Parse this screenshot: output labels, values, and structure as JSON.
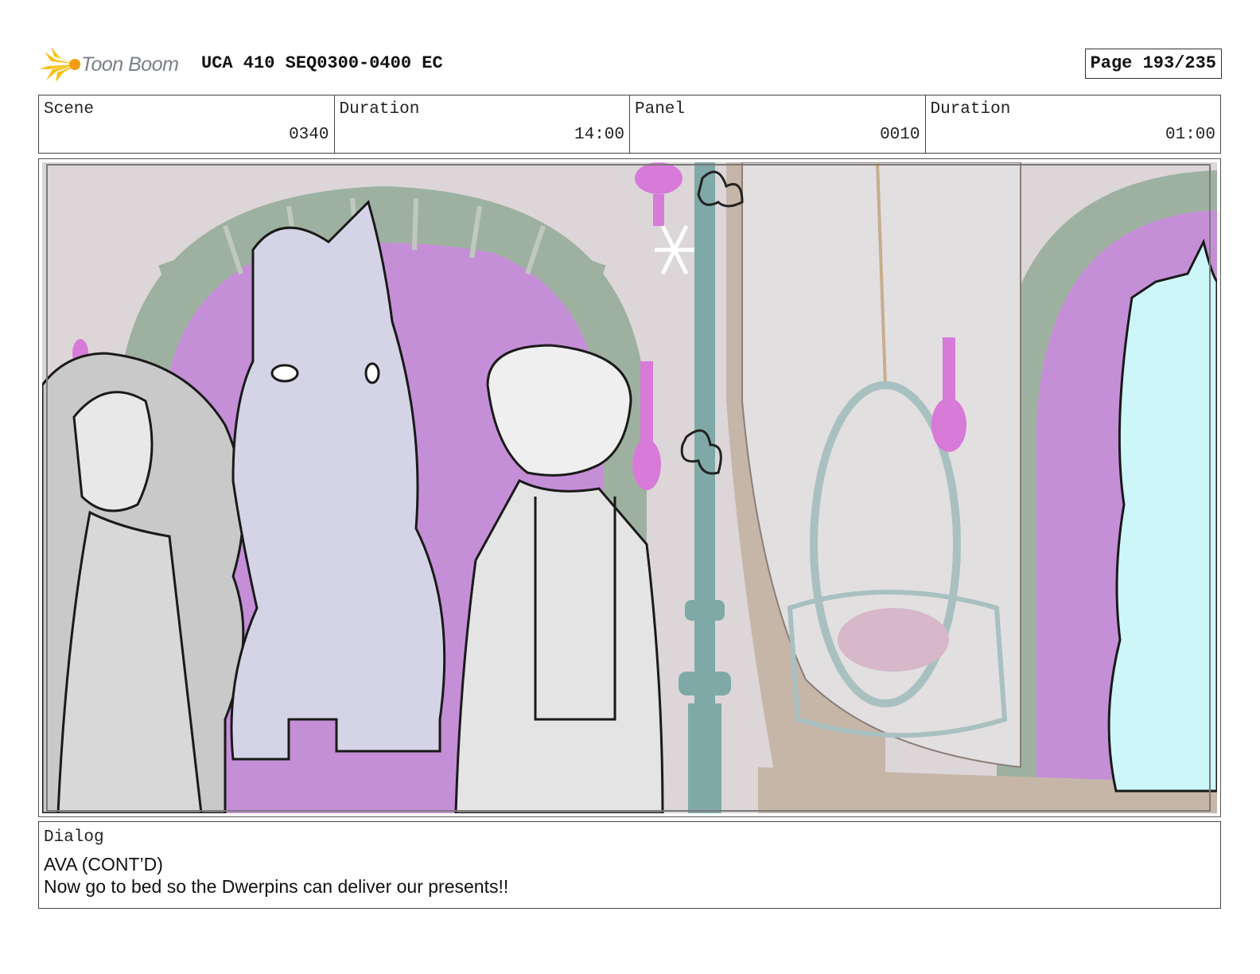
{
  "header": {
    "logo_text": "Toon Boom",
    "title": "UCA 410 SEQ0300-0400 EC",
    "page": "Page 193/235"
  },
  "info": {
    "scene_label": "Scene",
    "scene_value": "0340",
    "scene_duration_label": "Duration",
    "scene_duration_value": "14:00",
    "panel_label": "Panel",
    "panel_value": "0010",
    "panel_duration_label": "Duration",
    "panel_duration_value": "01:00"
  },
  "dialog": {
    "label": "Dialog",
    "speaker": "AVA (CONT’D)",
    "line": "Now go to bed so the Dwerpins can deliver our presents!!"
  },
  "colors": {
    "logo_accent": "#f6c21a",
    "wall": "#d9d4d6",
    "window_magenta": "#c58fd8",
    "arch_green": "#9eb1a0",
    "floor": "#c6b6a8",
    "horse_lavender": "#d4d4e6",
    "unicorn_cyan": "#cdf6f8",
    "lamp_post": "#7fa9a6"
  }
}
